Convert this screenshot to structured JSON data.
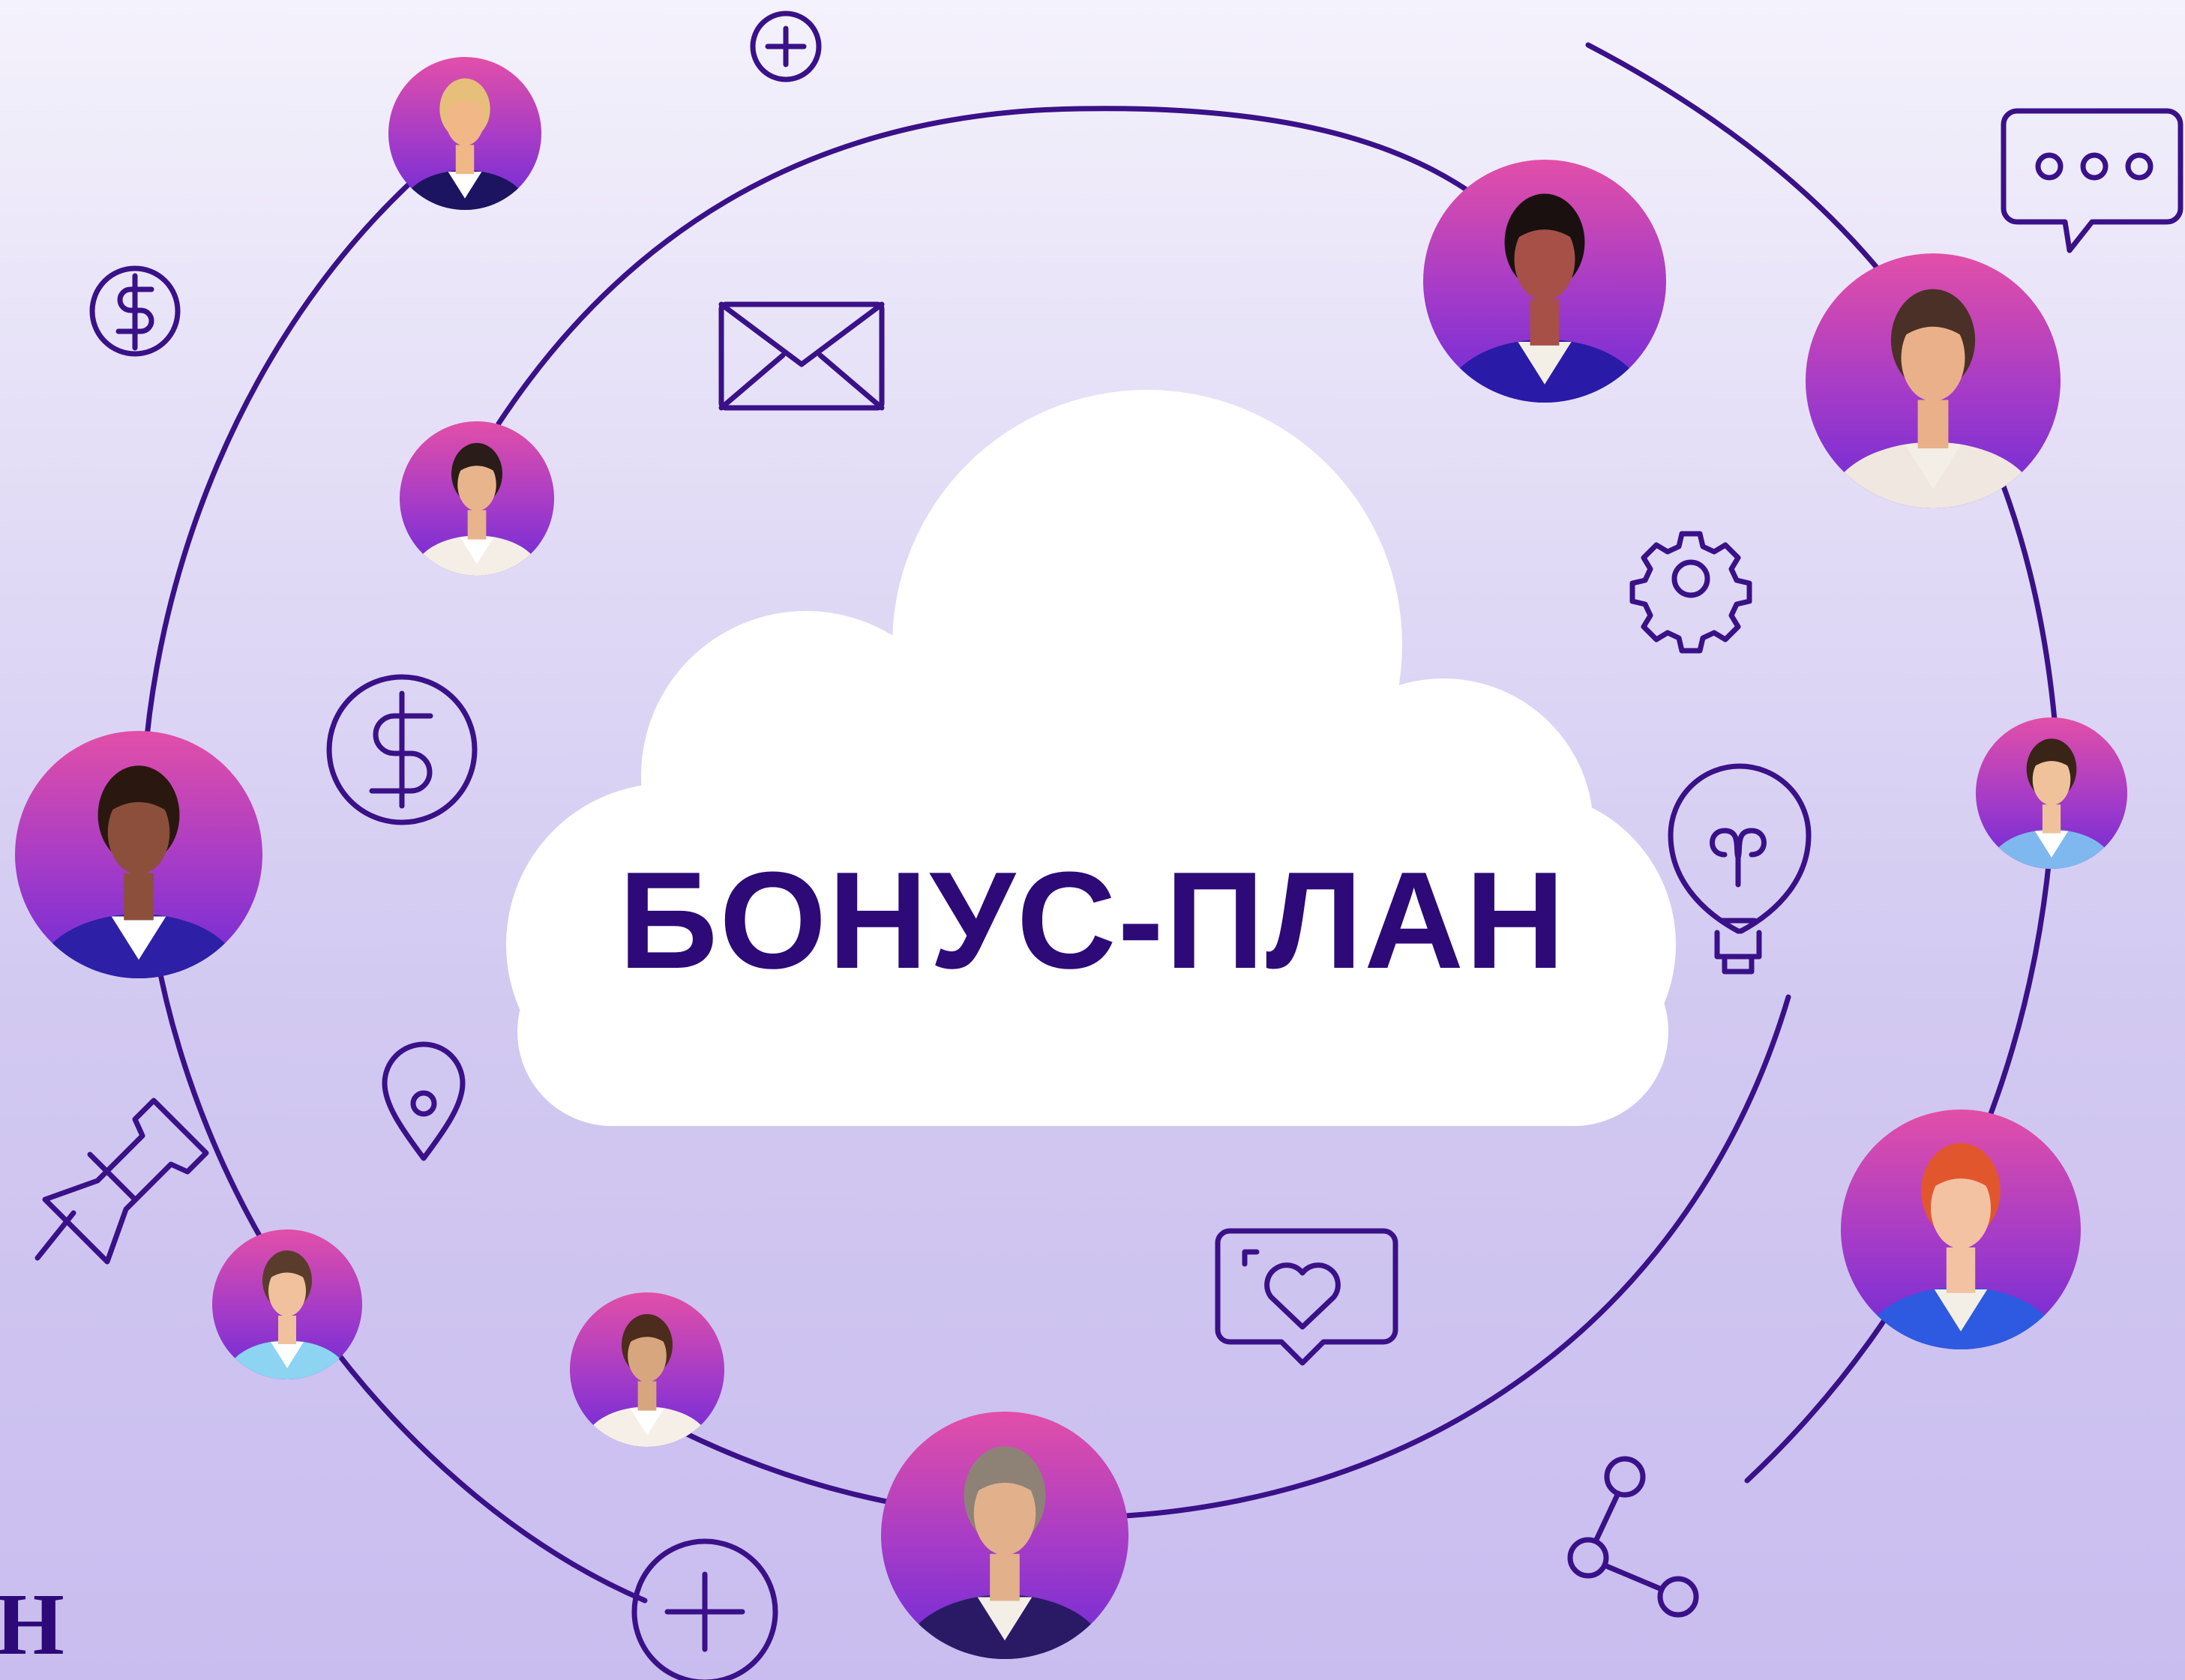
{
  "slide": {
    "title": "БОНУС-ПЛАН",
    "corner_text": "Н"
  },
  "colors": {
    "title": "#2d0a78",
    "line": "#3a1188",
    "avatar_gradient_top": "#e24fa8",
    "avatar_gradient_bottom": "#7a2ed6",
    "cloud": "#ffffff"
  },
  "icons": [
    "plus-circle-icon",
    "dollar-circle-icon",
    "mail-icon",
    "chat-bubble-icon",
    "gear-icon",
    "lightbulb-icon",
    "location-pin-icon",
    "pushpin-icon",
    "heart-message-icon",
    "share-icon"
  ],
  "avatars": [
    "avatar-blonde-woman-glasses",
    "avatar-black-woman-braids",
    "avatar-man-suspenders",
    "avatar-man-beard-white-jacket",
    "avatar-woman-glasses-long-hair",
    "avatar-young-man",
    "avatar-redhead-man",
    "avatar-woman-short-hair",
    "avatar-man-curly-hair",
    "avatar-senior-man-glasses"
  ]
}
